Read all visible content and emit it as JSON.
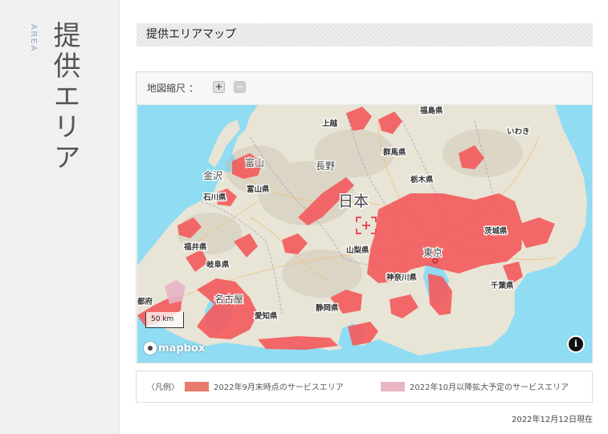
{
  "side": {
    "title_en": "AREA",
    "title_jp": "提供エリア"
  },
  "heading": "提供エリアマップ",
  "zoom": {
    "label": "地図縮尺 ：",
    "zoom_in": "+",
    "zoom_out": "−"
  },
  "map": {
    "scale_label": "50 km",
    "attribution": "mapbox",
    "info_icon": "info-icon",
    "country_label": "日本",
    "place_labels": [
      "福島県",
      "上越",
      "いわき",
      "群馬県",
      "栃木県",
      "富山",
      "長野",
      "金沢",
      "富山県",
      "石川県",
      "福井県",
      "山梨県",
      "茨城県",
      "東京",
      "岐阜県",
      "神奈川県",
      "千葉県",
      "名古屋",
      "愛知県",
      "静岡県",
      "都府"
    ],
    "colors": {
      "water": "#8fdcf3",
      "land": "#e8e4d6",
      "coverage": "#f45a5c",
      "planned": "#e7b4c4"
    }
  },
  "legend": {
    "label": "〈凡例〉",
    "items": [
      {
        "text": "2022年9月末時点のサービスエリア",
        "color": "#e87a6c"
      },
      {
        "text": "2022年10月以降拡大予定のサービスエリア",
        "color": "#e8b6c2"
      }
    ]
  },
  "as_of": "2022年12月12日現在"
}
